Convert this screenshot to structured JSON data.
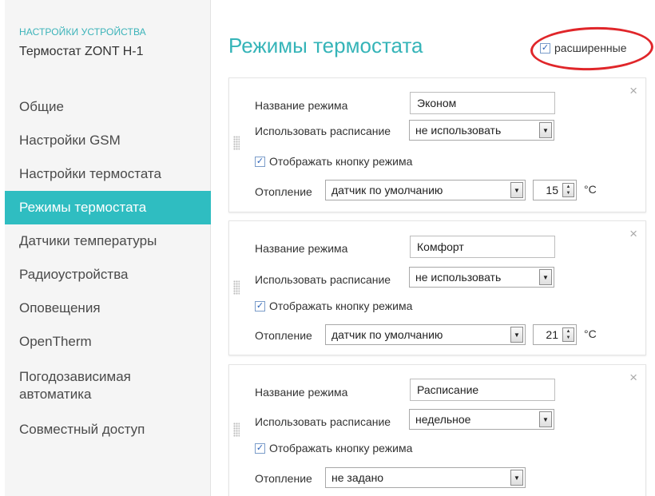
{
  "sidebar": {
    "section_label": "НАСТРОЙКИ УСТРОЙСТВА",
    "device_name": "Термостат ZONT H-1",
    "items": [
      {
        "label": "Общие",
        "active": false
      },
      {
        "label": "Настройки GSM",
        "active": false
      },
      {
        "label": "Настройки термостата",
        "active": false
      },
      {
        "label": "Режимы термостата",
        "active": true
      },
      {
        "label": "Датчики температуры",
        "active": false
      },
      {
        "label": "Радиоустройства",
        "active": false
      },
      {
        "label": "Оповещения",
        "active": false
      },
      {
        "label": "OpenTherm",
        "active": false
      },
      {
        "label": "Погодозависимая\nавтоматика",
        "active": false
      },
      {
        "label": "Совместный доступ",
        "active": false
      }
    ]
  },
  "main": {
    "title": "Режимы термостата",
    "advanced_label": "расширенные",
    "advanced_checked": true,
    "modes": [
      {
        "name_label": "Название режима",
        "name_value": "Эконом",
        "schedule_label": "Использовать расписание",
        "schedule_value": "не использовать",
        "show_button_label": "Отображать кнопку режима",
        "show_button_checked": true,
        "heating_label": "Отопление",
        "heating_value": "датчик по умолчанию",
        "temp_value": "15",
        "unit": "°C"
      },
      {
        "name_label": "Название режима",
        "name_value": "Комфорт",
        "schedule_label": "Использовать расписание",
        "schedule_value": "не использовать",
        "show_button_label": "Отображать кнопку режима",
        "show_button_checked": true,
        "heating_label": "Отопление",
        "heating_value": "датчик по умолчанию",
        "temp_value": "21",
        "unit": "°C"
      },
      {
        "name_label": "Название режима",
        "name_value": "Расписание",
        "schedule_label": "Использовать расписание",
        "schedule_value": "недельное",
        "show_button_label": "Отображать кнопку режима",
        "show_button_checked": true,
        "heating_label": "Отопление",
        "heating_value": "не задано"
      }
    ],
    "close_glyph": "×",
    "check_glyph": "✓",
    "dropdown_glyph": "▼",
    "spin_up_glyph": "▲",
    "spin_down_glyph": "▼"
  },
  "colors": {
    "accent": "#2fbdc1",
    "title": "#35b4b8",
    "highlight_oval": "#e0262a"
  }
}
